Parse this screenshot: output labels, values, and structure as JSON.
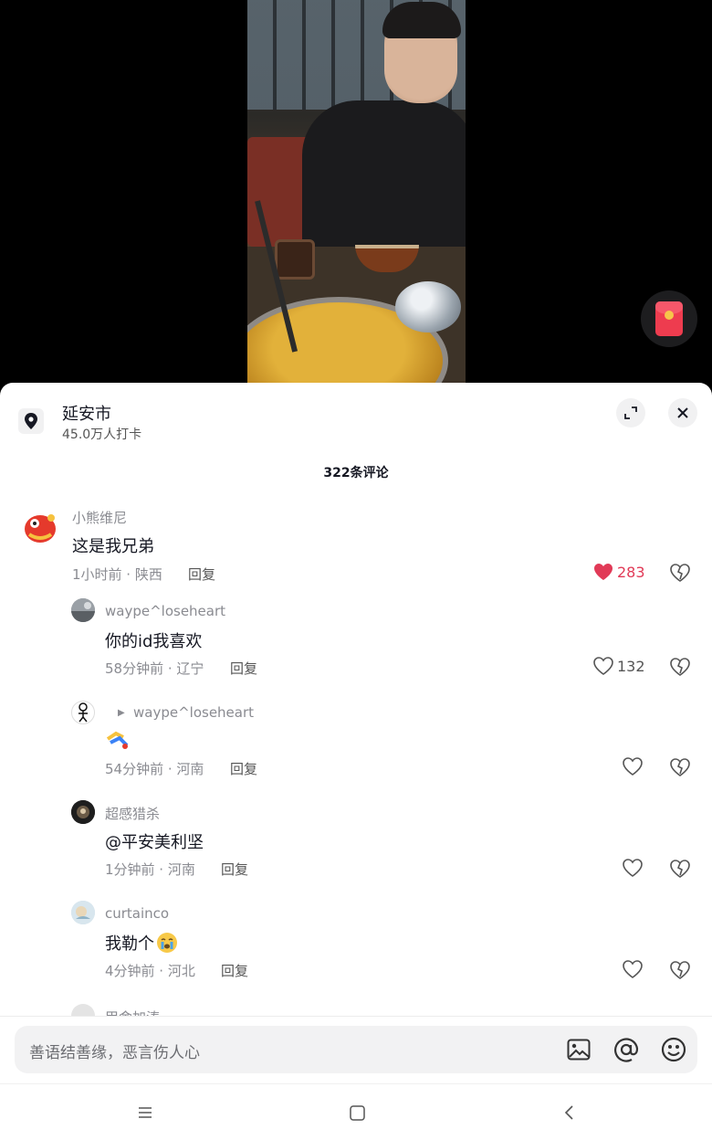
{
  "location": {
    "title": "延安市",
    "subtitle": "45.0万人打卡"
  },
  "comment_count_label": "322条评论",
  "reply_label": "回复",
  "comments": [
    {
      "author": "小熊维尼",
      "text": "这是我兄弟",
      "meta": "1小时前 · 陕西",
      "likes": "283",
      "liked": true
    },
    {
      "author": "waype^loseheart",
      "text": "你的id我喜欢",
      "meta": "58分钟前 · 辽宁",
      "likes": "132",
      "liked": false
    },
    {
      "author": "waype^loseheart",
      "text": "",
      "meta": "54分钟前 · 河南",
      "likes": "",
      "liked": false
    },
    {
      "author": "超感猎杀",
      "text": "@平安美利坚",
      "meta": "1分钟前 · 河南",
      "likes": "",
      "liked": false
    },
    {
      "author": "curtainco",
      "text": "我勒个",
      "meta": "4分钟前 · 河北",
      "likes": "",
      "liked": false
    },
    {
      "author": "甲舍加涛"
    }
  ],
  "input": {
    "placeholder": "善语结善缘，恶言伤人心"
  },
  "colors": {
    "like_active": "#e13a57",
    "text_primary": "#161823",
    "text_secondary": "#8a8b91"
  }
}
